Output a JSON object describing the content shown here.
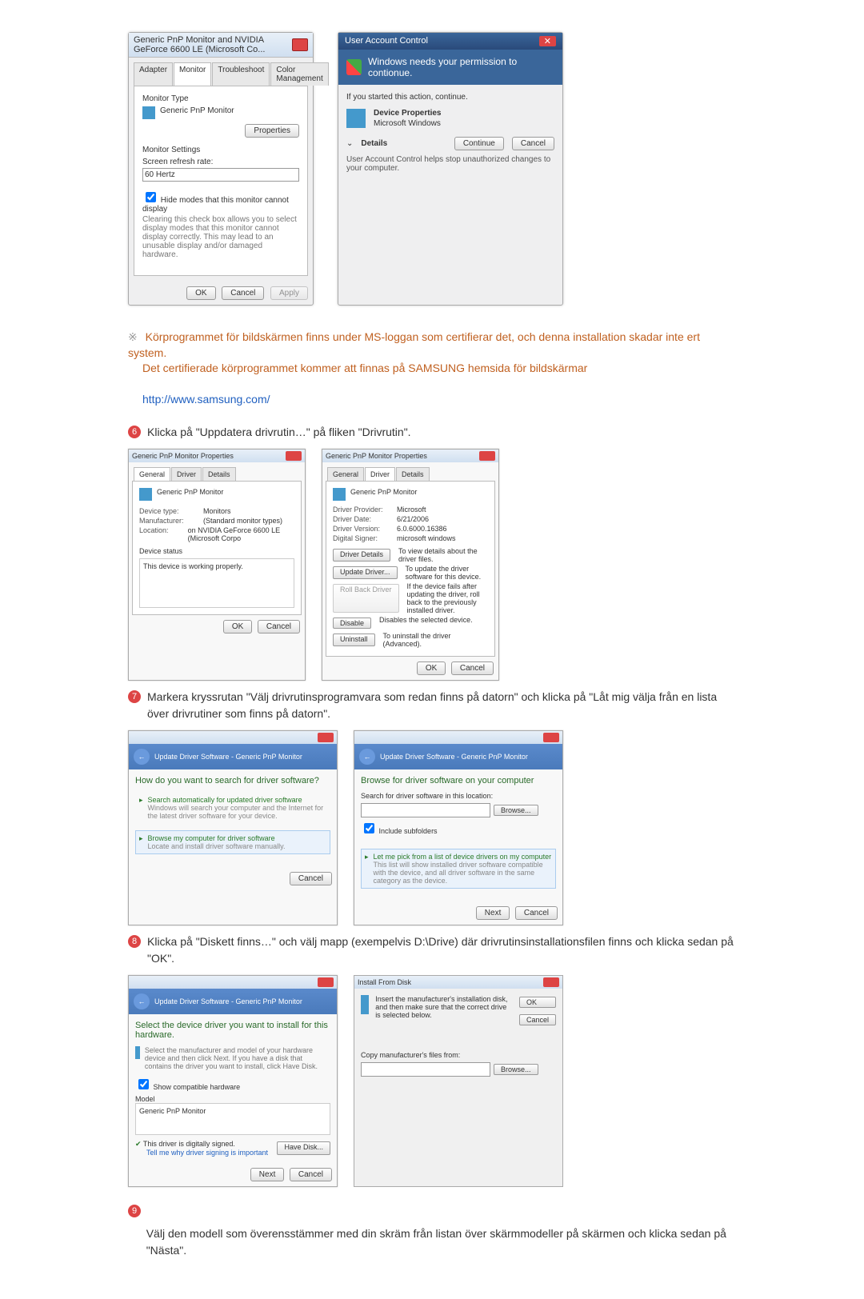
{
  "monitor_dialog": {
    "title": "Generic PnP Monitor and NVIDIA GeForce 6600 LE (Microsoft Co...",
    "tabs": [
      "Adapter",
      "Monitor",
      "Troubleshoot",
      "Color Management"
    ],
    "monitor_type_label": "Monitor Type",
    "monitor_name": "Generic PnP Monitor",
    "properties_btn": "Properties",
    "monitor_settings_label": "Monitor Settings",
    "refresh_label": "Screen refresh rate:",
    "refresh_value": "60 Hertz",
    "hide_modes_label": "Hide modes that this monitor cannot display",
    "hide_modes_desc": "Clearing this check box allows you to select display modes that this monitor cannot display correctly. This may lead to an unusable display and/or damaged hardware.",
    "ok": "OK",
    "cancel": "Cancel",
    "apply": "Apply"
  },
  "uac": {
    "title": "User Account Control",
    "perm_text": "Windows needs your permission to contionue.",
    "started_text": "If you started this action, continue.",
    "device_props": "Device Properties",
    "ms_windows": "Microsoft Windows",
    "details": "Details",
    "continue": "Continue",
    "cancel": "Cancel",
    "footer": "User Account Control helps stop unauthorized changes to your computer."
  },
  "note": {
    "line1": "Körprogrammet för bildskärmen finns under MS-loggan som certifierar det, och denna installation skadar inte ert system.",
    "line2": "Det certifierade körprogrammet kommer att finnas på SAMSUNG hemsida för bildskärmar",
    "url": "http://www.samsung.com/"
  },
  "step6": {
    "num": "6",
    "text": "Klicka på \"Uppdatera drivrutin…\" på fliken \"Drivrutin\"."
  },
  "props_general": {
    "title": "Generic PnP Monitor Properties",
    "tabs": [
      "General",
      "Driver",
      "Details"
    ],
    "header": "Generic PnP Monitor",
    "devtype_lbl": "Device type:",
    "devtype_val": "Monitors",
    "manu_lbl": "Manufacturer:",
    "manu_val": "(Standard monitor types)",
    "loc_lbl": "Location:",
    "loc_val": "on NVIDIA GeForce 6600 LE (Microsoft Corpo",
    "status_lbl": "Device status",
    "status_txt": "This device is working properly.",
    "ok": "OK",
    "cancel": "Cancel"
  },
  "props_driver": {
    "title": "Generic PnP Monitor Properties",
    "tabs": [
      "General",
      "Driver",
      "Details"
    ],
    "header": "Generic PnP Monitor",
    "provider_lbl": "Driver Provider:",
    "provider_val": "Microsoft",
    "date_lbl": "Driver Date:",
    "date_val": "6/21/2006",
    "version_lbl": "Driver Version:",
    "version_val": "6.0.6000.16386",
    "signer_lbl": "Digital Signer:",
    "signer_val": "microsoft windows",
    "btn_details": "Driver Details",
    "desc_details": "To view details about the driver files.",
    "btn_update": "Update Driver...",
    "desc_update": "To update the driver software for this device.",
    "btn_rollback": "Roll Back Driver",
    "desc_rollback": "If the device fails after updating the driver, roll back to the previously installed driver.",
    "btn_disable": "Disable",
    "desc_disable": "Disables the selected device.",
    "btn_uninstall": "Uninstall",
    "desc_uninstall": "To uninstall the driver (Advanced).",
    "ok": "OK",
    "cancel": "Cancel"
  },
  "step7": {
    "num": "7",
    "text": "Markera kryssrutan \"Välj drivrutinsprogramvara som redan finns på datorn\" och klicka på \"Låt mig välja från en lista över drivrutiner som finns på datorn\"."
  },
  "wizard1": {
    "breadcrumb": "Update Driver Software - Generic PnP Monitor",
    "head": "How do you want to search for driver software?",
    "opt1_title": "Search automatically for updated driver software",
    "opt1_desc": "Windows will search your computer and the Internet for the latest driver software for your device.",
    "opt2_title": "Browse my computer for driver software",
    "opt2_desc": "Locate and install driver software manually.",
    "cancel": "Cancel"
  },
  "wizard2": {
    "breadcrumb": "Update Driver Software - Generic PnP Monitor",
    "head": "Browse for driver software on your computer",
    "search_lbl": "Search for driver software in this location:",
    "browse": "Browse...",
    "include_sub": "Include subfolders",
    "opt_title": "Let me pick from a list of device drivers on my computer",
    "opt_desc": "This list will show installed driver software compatible with the device, and all driver software in the same category as the device.",
    "next": "Next",
    "cancel": "Cancel"
  },
  "step8": {
    "num": "8",
    "text": "Klicka på \"Diskett finns…\" och välj mapp (exempelvis D:\\Drive) där drivrutinsinstallationsfilen finns och klicka sedan på \"OK\"."
  },
  "wizard3": {
    "breadcrumb": "Update Driver Software - Generic PnP Monitor",
    "head": "Select the device driver you want to install for this hardware.",
    "desc": "Select the manufacturer and model of your hardware device and then click Next. If you have a disk that contains the driver you want to install, click Have Disk.",
    "show_compat": "Show compatible hardware",
    "model_lbl": "Model",
    "model_item": "Generic PnP Monitor",
    "signed": "This driver is digitally signed.",
    "tell_me": "Tell me why driver signing is important",
    "have_disk": "Have Disk...",
    "next": "Next",
    "cancel": "Cancel"
  },
  "install_disk": {
    "title": "Install From Disk",
    "msg": "Insert the manufacturer's installation disk, and then make sure that the correct drive is selected below.",
    "ok": "OK",
    "cancel": "Cancel",
    "copy_lbl": "Copy manufacturer's files from:",
    "browse": "Browse..."
  },
  "step9": {
    "num": "9",
    "text": "Välj den modell som överensstämmer med din skräm från listan över skärmmodeller på skärmen och klicka sedan på \"Nästa\"."
  }
}
